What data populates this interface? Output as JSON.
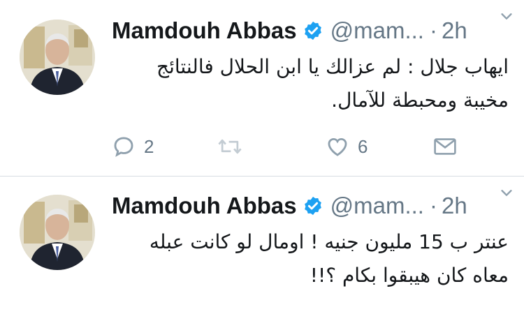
{
  "tweets": [
    {
      "author_name": "Mamdouh Abbas",
      "handle": "@mam...",
      "separator": "·",
      "time": "2h",
      "text_lines": [
        "ايهاب جلال : لم عزالك يا ابن الحلال فالنتائج",
        "مخيبة ومحبطة للآمال."
      ],
      "reply_count": "2",
      "like_count": "6"
    },
    {
      "author_name": "Mamdouh Abbas",
      "handle": "@mam...",
      "separator": "·",
      "time": "2h",
      "text_lines": [
        "عنتر ب 15 مليون جنيه ! اومال لو كانت عبله",
        "معاه كان هيبقوا بكام ؟!!"
      ]
    }
  ],
  "colors": {
    "verified": "#1da1f2",
    "meta_gray": "#657786",
    "icon_gray": "#8fa0ad",
    "divider": "#d7dde2"
  }
}
